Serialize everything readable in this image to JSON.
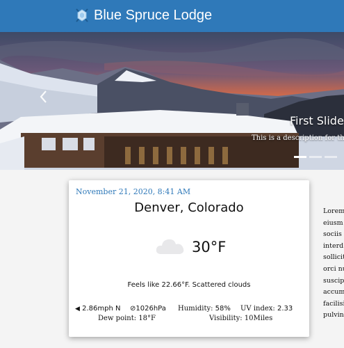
{
  "header": {
    "title": "Blue Spruce Lodge",
    "logo_icon": "spruce-logo-icon",
    "background": "#2f79b9"
  },
  "carousel": {
    "slide_title": "First Slide",
    "slide_description": "This is a description for the",
    "prev_icon": "chevron-left-icon",
    "indicator_count": 3,
    "active_indicator": 1
  },
  "weather": {
    "date": "November 21, 2020, 8:41 AM",
    "location": "Denver, Colorado",
    "condition_icon": "cloud-icon",
    "temperature": "30°F",
    "feels_like": "Feels like 22.66°F. Scattered clouds",
    "wind": "2.86mph N",
    "pressure": "1026hPa",
    "humidity_label": "Humidity:",
    "humidity_value": "58%",
    "uv_label": "UV index:",
    "uv_value": "2.33",
    "dew_point_label": "Dew point:",
    "dew_point_value": "18°F",
    "visibility_label": "Visibility:",
    "visibility_value": "10Miles",
    "accent_color": "#2f79b9"
  },
  "side_text": {
    "lines": [
      "Lorem",
      "eiusm",
      "sociis",
      "interd",
      "sollicit",
      "orci nu",
      "suscip",
      "accum",
      "facilisi",
      "pulvin"
    ]
  }
}
